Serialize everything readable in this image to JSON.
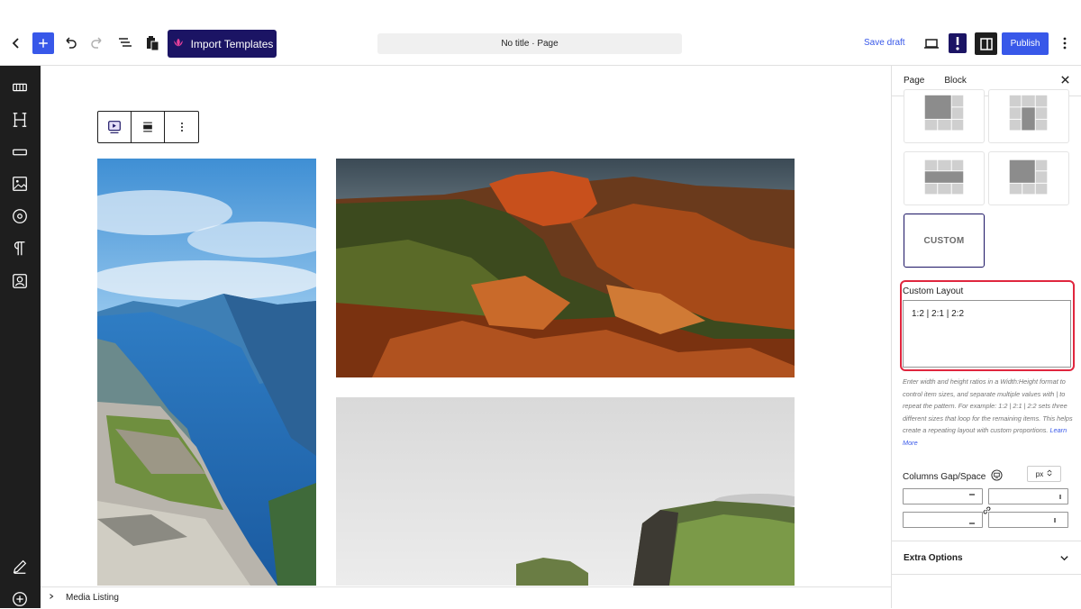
{
  "topbar": {
    "import_label": "Import Templates",
    "doc_title": "No title · Page",
    "save_draft": "Save draft",
    "publish": "Publish"
  },
  "right_panel": {
    "tab_page": "Page",
    "tab_block": "Block",
    "custom_tile": "CUSTOM",
    "custom_layout_label": "Custom Layout",
    "custom_layout_value": "1:2 | 2:1 | 2:2",
    "help_text": "Enter width and height ratios in a Width:Height format to control item sizes, and separate multiple values with | to repeat the pattern. For example: 1:2 | 2:1 | 2:2 sets three different sizes that loop for the remaining items. This helps create a repeating layout with custom proportions.",
    "learn_more": "Learn More",
    "gap_label": "Columns Gap/Space",
    "unit": "px",
    "extra_options": "Extra Options"
  },
  "breadcrumb": {
    "item": "Media Listing"
  },
  "colors": {
    "accent": "#3858e9",
    "import_bg": "#1b1464",
    "highlight": "#e0263e",
    "sidebar_bg": "#1e1e1e"
  }
}
